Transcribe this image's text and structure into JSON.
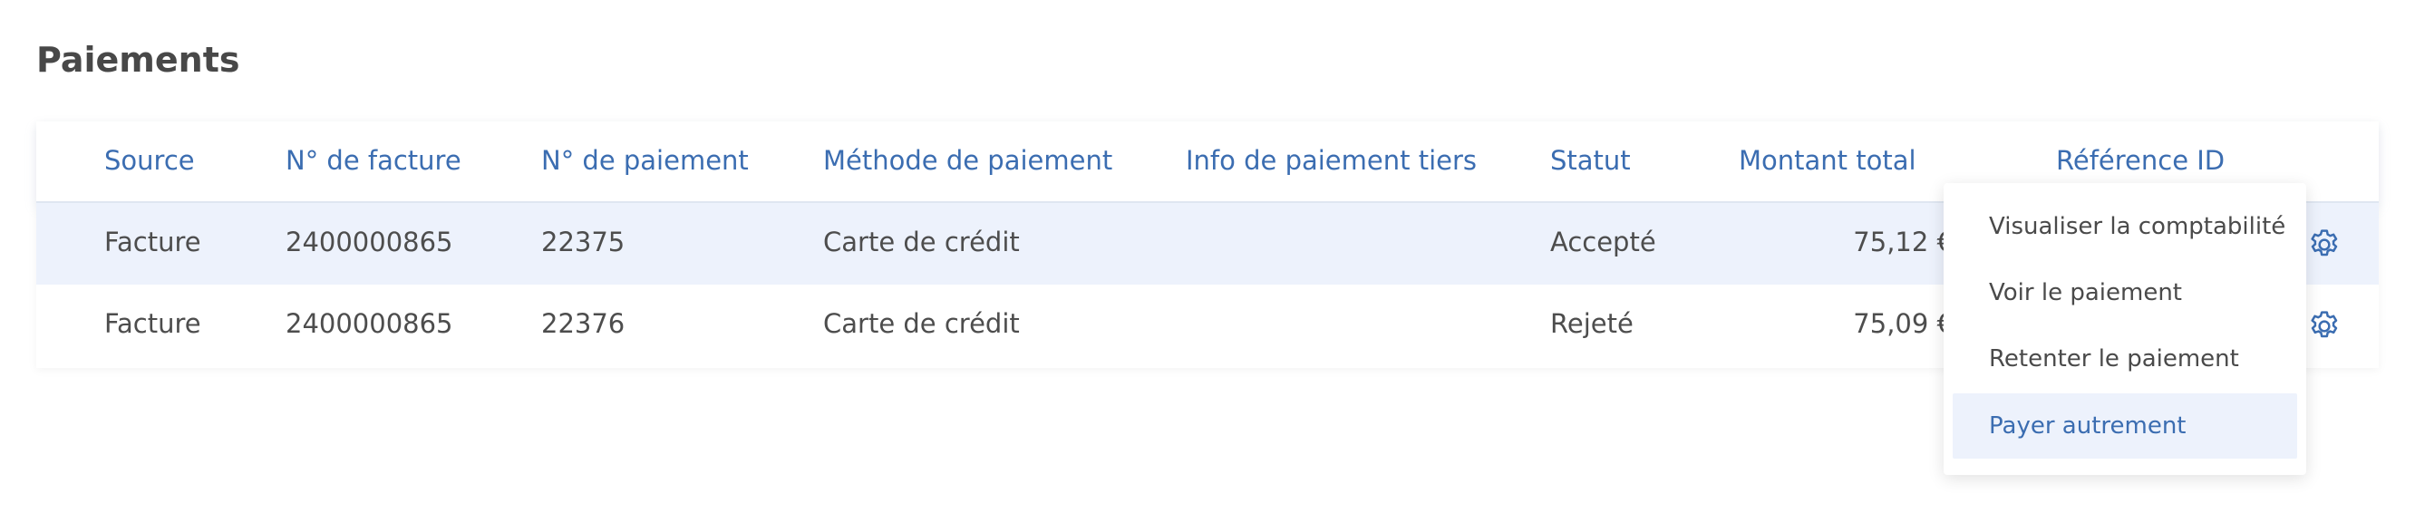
{
  "page": {
    "title": "Paiements"
  },
  "table": {
    "columns": [
      "Source",
      "N° de facture",
      "N° de paiement",
      "Méthode de paiement",
      "Info de paiement tiers",
      "Statut",
      "Montant total",
      "Référence ID"
    ],
    "rows": [
      {
        "source": "Facture",
        "invoice": "2400000865",
        "payment": "22375",
        "method": "Carte de crédit",
        "third_party": "",
        "status": "Accepté",
        "amount": "75,12 €",
        "reference": ""
      },
      {
        "source": "Facture",
        "invoice": "2400000865",
        "payment": "22376",
        "method": "Carte de crédit",
        "third_party": "",
        "status": "Rejeté",
        "amount": "75,09 €",
        "reference": ""
      }
    ]
  },
  "menu": {
    "items": [
      "Visualiser la comptabilité",
      "Voir le paiement",
      "Retenter le paiement",
      "Payer autrement"
    ],
    "active_index": 3
  },
  "icons": {
    "row_action": "gear-icon"
  },
  "colors": {
    "accent": "#3b6db1",
    "row_highlight": "#edf2fc",
    "text": "#4d4d4d"
  }
}
